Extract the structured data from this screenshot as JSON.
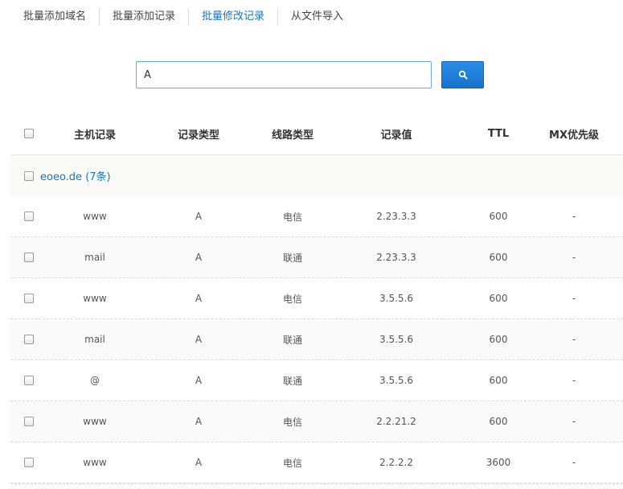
{
  "tabs": [
    {
      "label": "批量添加域名"
    },
    {
      "label": "批量添加记录"
    },
    {
      "label": "批量修改记录"
    },
    {
      "label": "从文件导入"
    }
  ],
  "search": {
    "value": "A",
    "icon": "search-icon"
  },
  "table": {
    "headers": {
      "host": "主机记录",
      "type": "记录类型",
      "line": "线路类型",
      "value": "记录值",
      "ttl": "TTL",
      "mx": "MX优先级"
    },
    "group": {
      "label": "eoeo.de (7条)"
    },
    "rows": [
      {
        "host": "www",
        "type": "A",
        "line": "电信",
        "value": "2.23.3.3",
        "ttl": "600",
        "mx": "-"
      },
      {
        "host": "mail",
        "type": "A",
        "line": "联通",
        "value": "2.23.3.3",
        "ttl": "600",
        "mx": "-"
      },
      {
        "host": "www",
        "type": "A",
        "line": "电信",
        "value": "3.5.5.6",
        "ttl": "600",
        "mx": "-"
      },
      {
        "host": "mail",
        "type": "A",
        "line": "联通",
        "value": "3.5.5.6",
        "ttl": "600",
        "mx": "-"
      },
      {
        "host": "@",
        "type": "A",
        "line": "联通",
        "value": "3.5.5.6",
        "ttl": "600",
        "mx": "-"
      },
      {
        "host": "www",
        "type": "A",
        "line": "电信",
        "value": "2.2.21.2",
        "ttl": "600",
        "mx": "-"
      },
      {
        "host": "www",
        "type": "A",
        "line": "电信",
        "value": "2.2.2.2",
        "ttl": "3600",
        "mx": "-"
      }
    ]
  }
}
